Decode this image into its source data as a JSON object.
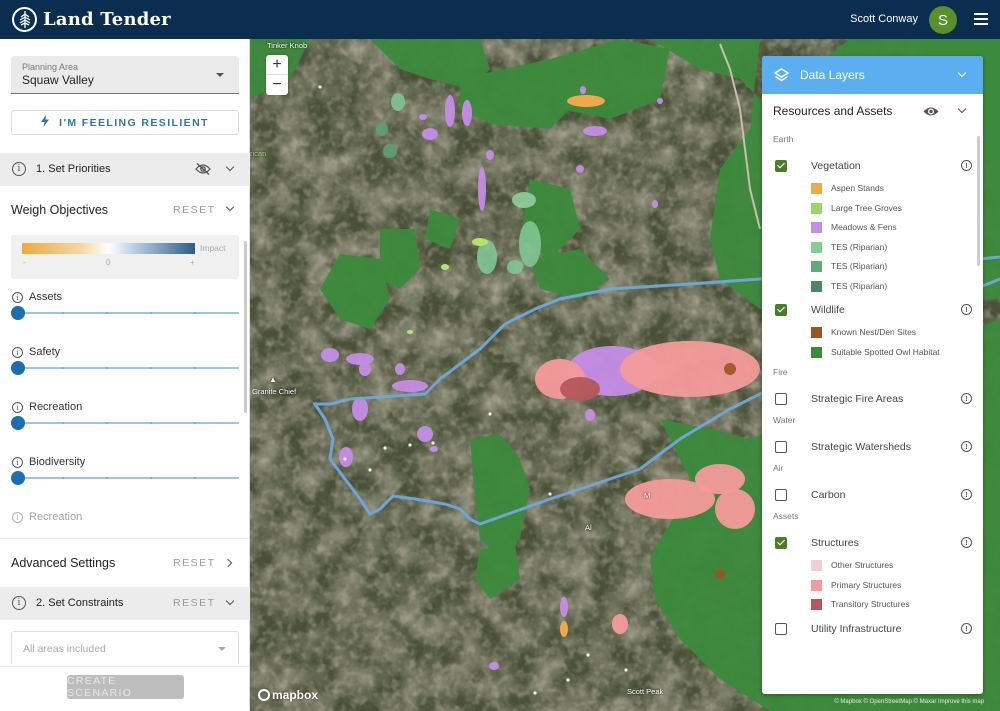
{
  "app": {
    "title": "Land Tender",
    "user_name": "Scott Conway",
    "user_initial": "S"
  },
  "sidebar": {
    "planning_area": {
      "label": "Planning Area",
      "value": "Squaw Valley"
    },
    "resilient_button": "I'M FEELING RESILIENT",
    "set_priorities": "1. Set Priorities",
    "weigh_objectives": {
      "title": "Weigh Objectives",
      "reset": "RESET"
    },
    "impact_scale": {
      "label": "Impact",
      "min": "-",
      "mid": "0",
      "max": "+"
    },
    "objectives": [
      {
        "label": "Assets",
        "value": 0
      },
      {
        "label": "Safety",
        "value": 0
      },
      {
        "label": "Recreation",
        "value": 0
      },
      {
        "label": "Biodiversity",
        "value": 0
      },
      {
        "label": "Recreation",
        "value": 0
      }
    ],
    "advanced_settings": {
      "title": "Advanced Settings",
      "reset": "RESET"
    },
    "set_constraints": {
      "title": "2. Set Constraints",
      "reset": "RESET"
    },
    "constraint_placeholder": "All areas included",
    "create_button": "CREATE SCENARIO"
  },
  "map": {
    "zoom_in": "+",
    "zoom_out": "−",
    "place_labels": [
      "Tinker Knob",
      "Granite Chief",
      "Scott Peak",
      "rican",
      "Al",
      "M"
    ],
    "logo": "mapbox",
    "attribution": "© Mapbox © OpenStreetMap © Maxar Improve this map"
  },
  "layers_panel": {
    "title": "Data Layers",
    "group_title": "Resources and Assets",
    "categories": [
      {
        "name": "Earth",
        "layers": [
          {
            "name": "Vegetation",
            "checked": true,
            "legend": [
              {
                "name": "Aspen Stands",
                "color": "#f0a94a"
              },
              {
                "name": "Large Tree Groves",
                "color": "#9ed36a"
              },
              {
                "name": "Meadows & Fens",
                "color": "#c58de6"
              },
              {
                "name": "TES (Riparian)",
                "color": "#7fcf93"
              },
              {
                "name": "TES (Riparian)",
                "color": "#64a97a"
              },
              {
                "name": "TES (Riparian)",
                "color": "#4e8661"
              }
            ]
          },
          {
            "name": "Wildlife",
            "checked": true,
            "legend": [
              {
                "name": "Known Nest/Den Sites",
                "color": "#9a5520"
              },
              {
                "name": "Suitable Spotted Owl Habitat",
                "color": "#3a8a3a"
              }
            ]
          }
        ]
      },
      {
        "name": "Fire",
        "layers": [
          {
            "name": "Strategic Fire Areas",
            "checked": false,
            "legend": []
          }
        ]
      },
      {
        "name": "Water",
        "layers": [
          {
            "name": "Strategic Watersheds",
            "checked": false,
            "legend": []
          }
        ]
      },
      {
        "name": "Air",
        "layers": [
          {
            "name": "Carbon",
            "checked": false,
            "legend": []
          }
        ]
      },
      {
        "name": "Assets",
        "layers": [
          {
            "name": "Structures",
            "checked": true,
            "legend": [
              {
                "name": "Other Structures",
                "color": "#f1cfd3"
              },
              {
                "name": "Primary Structures",
                "color": "#f49a9a"
              },
              {
                "name": "Transitory Structures",
                "color": "#b5575b"
              }
            ]
          },
          {
            "name": "Utility Infrastructure",
            "checked": false,
            "legend": []
          }
        ]
      }
    ]
  },
  "colors": {
    "header_bg": "#0b2d4f",
    "accent_blue": "#1a6fb0",
    "layers_header": "#5baef0",
    "checkbox_green": "#4b7d29",
    "avatar_green": "#5a8f29",
    "boundary_line": "#6fa8dc"
  }
}
